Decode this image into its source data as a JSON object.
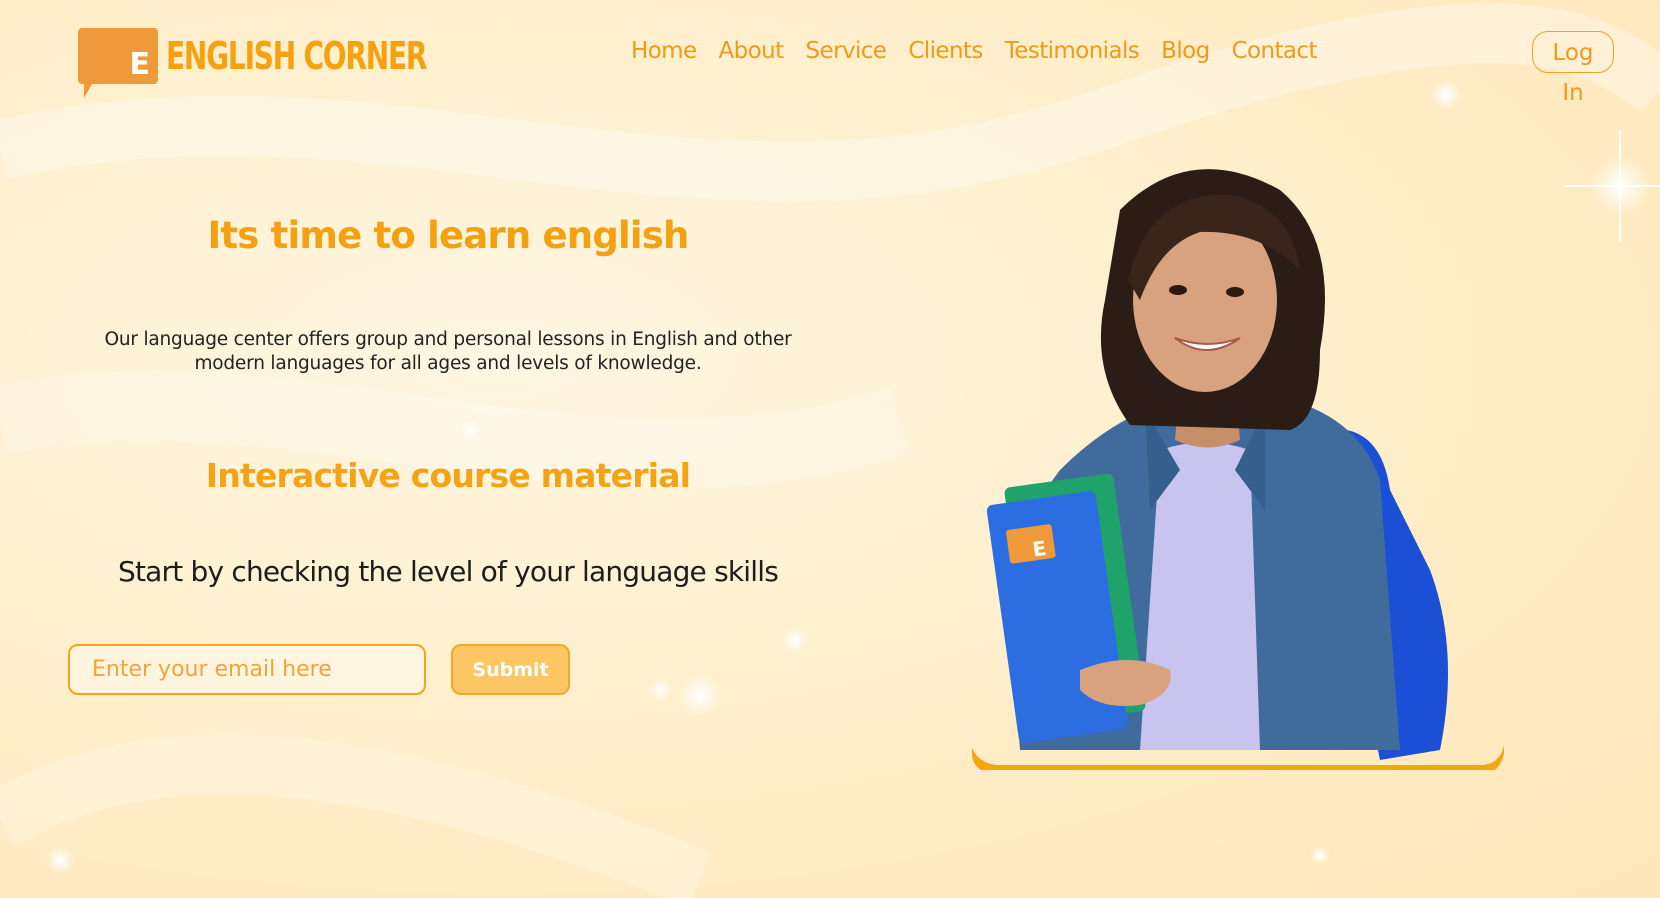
{
  "brand": {
    "logo_letter": "E",
    "name": "ENGLISH CORNER"
  },
  "nav": {
    "items": [
      {
        "label": "Home"
      },
      {
        "label": "About"
      },
      {
        "label": "Service"
      },
      {
        "label": "Clients"
      },
      {
        "label": "Testimonials"
      },
      {
        "label": "Blog"
      },
      {
        "label": "Contact"
      }
    ],
    "login_label": "Log In"
  },
  "hero": {
    "title": "Its time to learn english",
    "description": "Our language center offers group and personal lessons in English and other modern languages for all ages and levels of knowledge.",
    "subtitle": "Interactive course material",
    "cta_text": "Start by checking the level of your language skills",
    "email_placeholder": "Enter your email here",
    "email_value": "",
    "submit_label": "Submit",
    "image": {
      "subject": "student-photo",
      "folder_logo_letter": "E"
    }
  },
  "colors": {
    "accent": "#f5a00f",
    "logo_orange": "#ef9a3a",
    "background": "#ffefcd",
    "text_dark": "#222222",
    "button_fill": "#fcc662"
  }
}
